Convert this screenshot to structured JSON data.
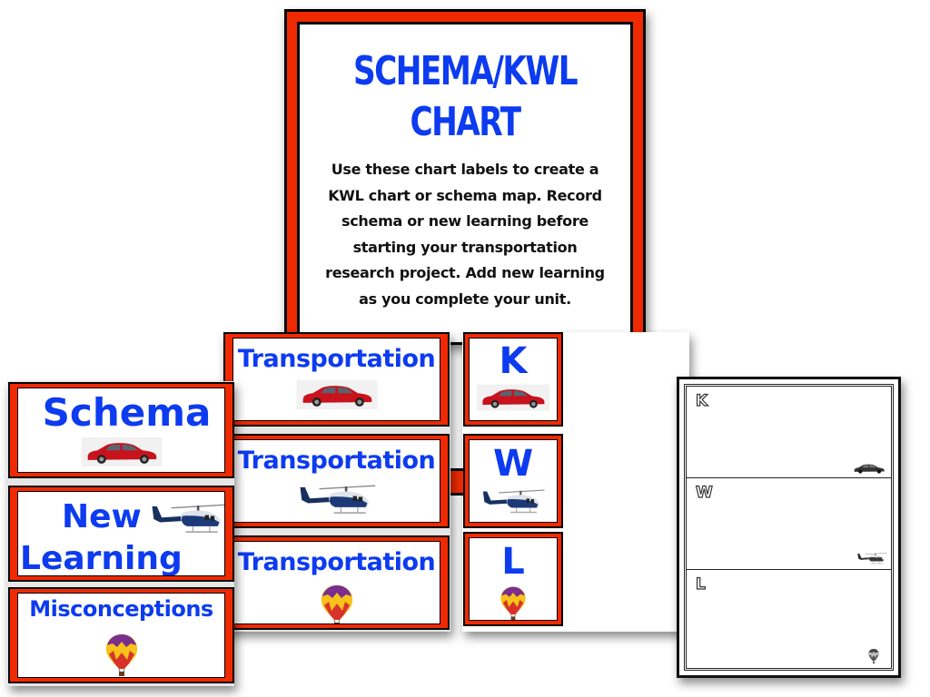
{
  "poster": {
    "title_line1": "SCHEMA/KWL",
    "title_line2": "CHART",
    "instructions": [
      "Use these chart labels to create a",
      "KWL chart or schema map. Record",
      "schema or new learning before",
      "starting your transportation",
      "research project.  Add new learning",
      "as you complete your unit."
    ]
  },
  "schema_cards": [
    {
      "label": "Schema",
      "icon": "car-icon"
    },
    {
      "label_line1": "New",
      "label_line2": "Learning",
      "icon": "helicopter-icon"
    },
    {
      "label": "Misconceptions",
      "icon": "hot-air-balloon-icon"
    }
  ],
  "transportation_cards": [
    {
      "label": "Transportation",
      "icon": "car-icon"
    },
    {
      "label": "Transportation",
      "icon": "helicopter-icon"
    },
    {
      "label": "Transportation",
      "icon": "hot-air-balloon-icon"
    }
  ],
  "kwl_cards": [
    {
      "label": "K",
      "icon": "car-icon"
    },
    {
      "label": "W",
      "icon": "helicopter-icon"
    },
    {
      "label": "L",
      "icon": "hot-air-balloon-icon"
    }
  ],
  "worksheet": {
    "rows": [
      {
        "letter": "K",
        "icon": "car-icon"
      },
      {
        "letter": "W",
        "icon": "helicopter-icon"
      },
      {
        "letter": "L",
        "icon": "hot-air-balloon-icon"
      }
    ]
  },
  "colors": {
    "card_red": "#f02a00",
    "label_blue": "#0c3bf0",
    "border_black": "#000000"
  }
}
